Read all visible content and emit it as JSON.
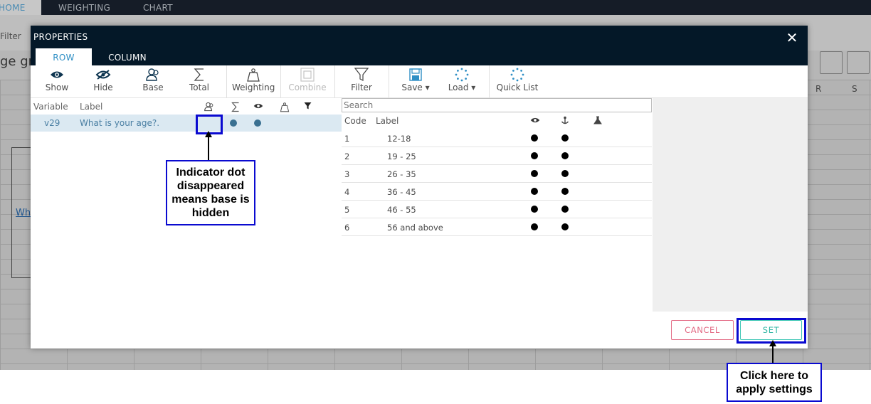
{
  "background": {
    "tabs": [
      "HOME",
      "WEIGHTING",
      "CHART"
    ],
    "filter_label": "Filter",
    "title_fragment": "ge gr",
    "column_headers": [
      "R",
      "S"
    ],
    "link_fragment": "Wh"
  },
  "modal": {
    "title": "PROPERTIES",
    "close_label": "✕",
    "tabs": [
      {
        "label": "ROW",
        "active": true
      },
      {
        "label": "COLUMN",
        "active": false
      }
    ],
    "toolbar": [
      {
        "label": "Show",
        "icon": "eye-icon",
        "enabled": true
      },
      {
        "label": "Hide",
        "icon": "eye-slash-icon",
        "enabled": true
      },
      {
        "label": "Base",
        "icon": "users-icon",
        "enabled": true
      },
      {
        "label": "Total",
        "icon": "sigma-icon",
        "enabled": true
      },
      {
        "label": "Weighting",
        "icon": "weight-icon",
        "enabled": true
      },
      {
        "label": "Combine",
        "icon": "combine-icon",
        "enabled": false
      },
      {
        "label": "Filter",
        "icon": "funnel-icon",
        "enabled": true
      },
      {
        "label": "Save ▾",
        "icon": "floppy-icon",
        "enabled": true
      },
      {
        "label": "Load ▾",
        "icon": "spinner-icon",
        "enabled": true
      },
      {
        "label": "Quick List",
        "icon": "spinner-icon",
        "enabled": true
      }
    ],
    "variables_table": {
      "headers": {
        "variable": "Variable",
        "label": "Label"
      },
      "rows": [
        {
          "variable": "v29",
          "label": "What is your age?."
        }
      ]
    },
    "values_table": {
      "search_placeholder": "Search",
      "headers": {
        "code": "Code",
        "label": "Label"
      },
      "rows": [
        {
          "code": "1",
          "label": "12-18"
        },
        {
          "code": "2",
          "label": "19 - 25"
        },
        {
          "code": "3",
          "label": "26 - 35"
        },
        {
          "code": "4",
          "label": "36 - 45"
        },
        {
          "code": "5",
          "label": "46 - 55"
        },
        {
          "code": "6",
          "label": "56 and above"
        }
      ]
    },
    "buttons": {
      "cancel": "CANCEL",
      "set": "SET"
    }
  },
  "annotations": {
    "base_hidden_note": "Indicator dot disappeared means base is hidden",
    "set_note": "Click here to apply settings"
  },
  "colors": {
    "header_bg": "#041828",
    "tab_active_text": "#2f8fc5",
    "selected_row_bg": "#dbe9f2",
    "cancel": "#e36b85",
    "set": "#35b7a6",
    "annotation_border": "#0a0ad0"
  }
}
